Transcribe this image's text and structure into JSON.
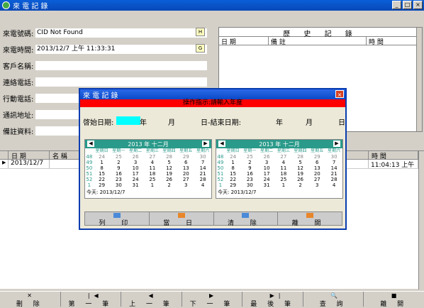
{
  "window": {
    "title": "來 電 記 錄",
    "min": "_",
    "max": "□",
    "close": "×"
  },
  "form": {
    "fields": [
      {
        "label": "來電號碼:",
        "value": "CID Not Found",
        "btn": "H"
      },
      {
        "label": "來電時間:",
        "value": "2013/12/7 上午 11:33:31",
        "btn": "G"
      },
      {
        "label": "客戶名稱:",
        "value": ""
      },
      {
        "label": "連絡電話:",
        "value": ""
      },
      {
        "label": "行動電話:",
        "value": ""
      },
      {
        "label": "通訊地址:",
        "value": ""
      },
      {
        "label": "備註資料:",
        "value": ""
      }
    ]
  },
  "history": {
    "title": "歷 史 記 錄",
    "cols": [
      "日 期",
      "備 註",
      "時 間"
    ]
  },
  "grid": {
    "cols": [
      "日 期",
      "名 稱",
      "時 間"
    ],
    "rows": [
      {
        "date": "2013/12/7",
        "time": "11:04:13 上午"
      }
    ]
  },
  "dialog": {
    "title": "來 電 記 錄",
    "instruction": "操作指示:請輸入年度",
    "start_label": "啓始日期:",
    "year": "年",
    "month": "月",
    "day": "日",
    "end_label": "-結束日期:",
    "calendars": [
      {
        "header": "2013 年 十二月",
        "today": "今天: 2013/12/7"
      },
      {
        "header": "2013 年 十二月",
        "today": "今天: 2013/12/7"
      }
    ],
    "weekdays": [
      "星期日",
      "星期一",
      "星期二",
      "星期三",
      "星期四",
      "星期五",
      "星期六"
    ],
    "weeks": [
      "48",
      "49",
      "50",
      "51",
      "52",
      "1"
    ],
    "days": [
      [
        "24",
        "25",
        "26",
        "27",
        "28",
        "29",
        "30"
      ],
      [
        "1",
        "2",
        "3",
        "4",
        "5",
        "6",
        "7"
      ],
      [
        "8",
        "9",
        "10",
        "11",
        "12",
        "13",
        "14"
      ],
      [
        "15",
        "16",
        "17",
        "18",
        "19",
        "20",
        "21"
      ],
      [
        "22",
        "23",
        "24",
        "25",
        "26",
        "27",
        "28"
      ],
      [
        "29",
        "30",
        "31",
        "1",
        "2",
        "3",
        "4"
      ]
    ],
    "buttons": [
      "列 印",
      "當 日",
      "清 除",
      "離 開"
    ]
  },
  "toolbar": [
    "刪 除",
    "第 一 筆",
    "上 一 筆",
    "下 一 筆",
    "最 後 筆",
    "查 詢",
    "離 開"
  ]
}
